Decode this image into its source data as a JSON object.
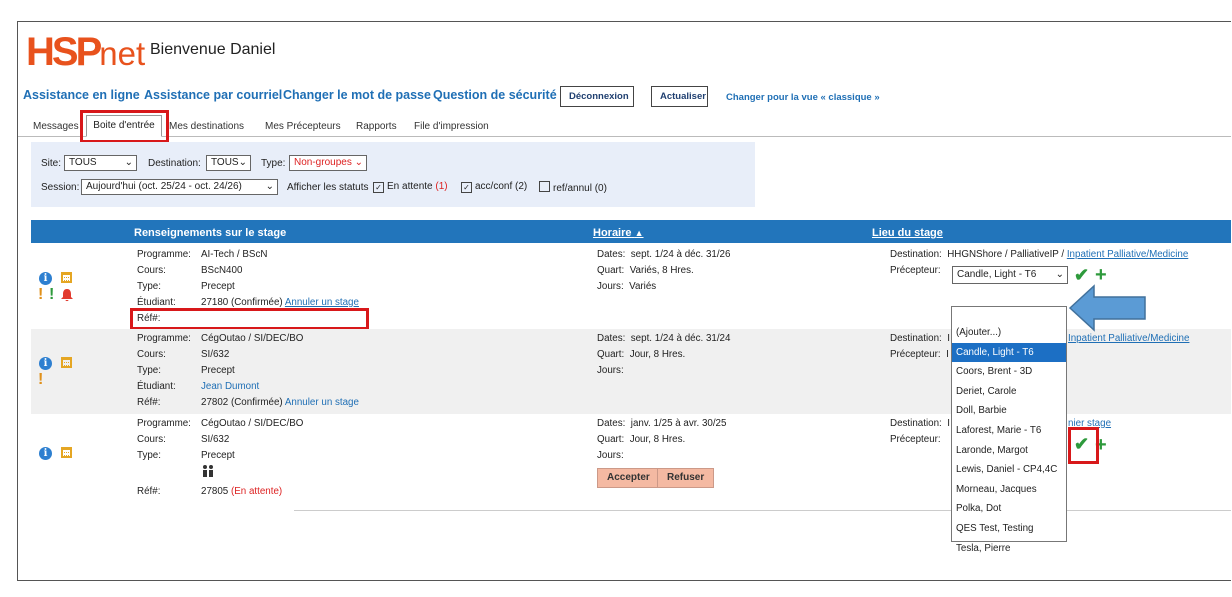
{
  "header": {
    "logo": {
      "main": "HSP",
      "suffix": "net"
    },
    "welcome": "Bienvenue Daniel",
    "nav_links": [
      "Assistance en ligne",
      "Assistance par courriel",
      "Changer le mot de passe",
      "Question de sécurité"
    ],
    "logout_label": "Déconnexion",
    "refresh_label": "Actualiser",
    "classic_view_link": "Changer pour la vue « classique »"
  },
  "tabs": [
    "Messages",
    "Boite d'entrée",
    "Mes destinations",
    "Mes Précepteurs",
    "Rapports",
    "File d'impression"
  ],
  "active_tab": "Boite d'entrée",
  "filter": {
    "site_label": "Site:",
    "site_value": "TOUS",
    "destination_label": "Destination:",
    "destination_value": "TOUS",
    "type_label": "Type:",
    "type_value": "Non-groupes",
    "session_label": "Session:",
    "session_value": "Aujourd'hui (oct. 25/24 - oct. 24/26)",
    "status_label": "Afficher les statuts",
    "status_pending": "En attente",
    "status_pending_count": "(1)",
    "status_acc": "acc/conf (2)",
    "status_ref": "ref/annul (0)"
  },
  "table": {
    "headers": {
      "info": "Renseignements sur le stage",
      "schedule": "Horaire",
      "schedule_sort": "▲",
      "location": "Lieu du stage"
    },
    "labels": {
      "program": "Programme:",
      "course": "Cours:",
      "type": "Type:",
      "student": "Étudiant:",
      "ref": "Réf#:",
      "dates": "Dates:",
      "shift": "Quart:",
      "days": "Jours:",
      "destination": "Destination:",
      "preceptor": "Précepteur:"
    },
    "rows": [
      {
        "program": "AI-Tech / BScN",
        "course": "BScN400",
        "type": "Precept",
        "student": "",
        "ref": "27180 (Confirmée)",
        "ref_action": "Annuler un stage",
        "dates": "sept. 1/24 à déc. 31/26",
        "shift": "Variés, 8 Hres.",
        "days": "Variés",
        "destination_prefix": "HHGNShore / PalliativeIP /",
        "destination_link": "Inpatient Palliative/Medicine",
        "preceptor_select": "Candle, Light - T6"
      },
      {
        "program": "CégOutao / SI/DEC/BO",
        "course": "SI/632",
        "type": "Precept",
        "student": "Jean Dumont",
        "ref": "27802 (Confirmée)",
        "ref_action": "Annuler un stage",
        "dates": "sept. 1/24 à déc. 31/24",
        "shift": "Jour, 8 Hres.",
        "days": "",
        "destination_prefix": "I",
        "destination_link": "Inpatient Palliative/Medicine",
        "preceptor_prefix": "I"
      },
      {
        "program": "CégOutao / SI/DEC/BO",
        "course": "SI/632",
        "type": "Precept",
        "ref": "27805",
        "ref_status": "(En attente)",
        "dates": "janv. 1/25 à avr. 30/25",
        "shift": "Jour, 8 Hres.",
        "days": "",
        "accept_label": "Accepter",
        "refuse_label": "Refuser",
        "destination_prefix": "I",
        "destination_link": "nier stage"
      }
    ]
  },
  "preceptor_dropdown": {
    "options": [
      "(Ajouter...)",
      "Candle, Light - T6",
      "Coors, Brent - 3D",
      "Deriet, Carole",
      "Doll, Barbie",
      "Laforest, Marie - T6",
      "Laronde, Margot",
      "Lewis, Daniel - CP4,4C",
      "Morneau, Jacques",
      "Polka, Dot",
      "QES Test, Testing",
      "Tesla, Pierre"
    ],
    "highlighted": "Candle, Light - T6"
  },
  "colors": {
    "brand_orange": "#e8521d",
    "link_blue": "#1f6fb5",
    "header_blue": "#2275bb",
    "highlight_red": "#d8181a",
    "arrow_blue": "#5b9bd5",
    "success_green": "#2e9a3c"
  },
  "icons": [
    "info-icon",
    "calendar-icon",
    "alert-icon",
    "bell-icon",
    "group-icon",
    "checkmark-icon",
    "plus-icon",
    "arrow-left-icon"
  ]
}
